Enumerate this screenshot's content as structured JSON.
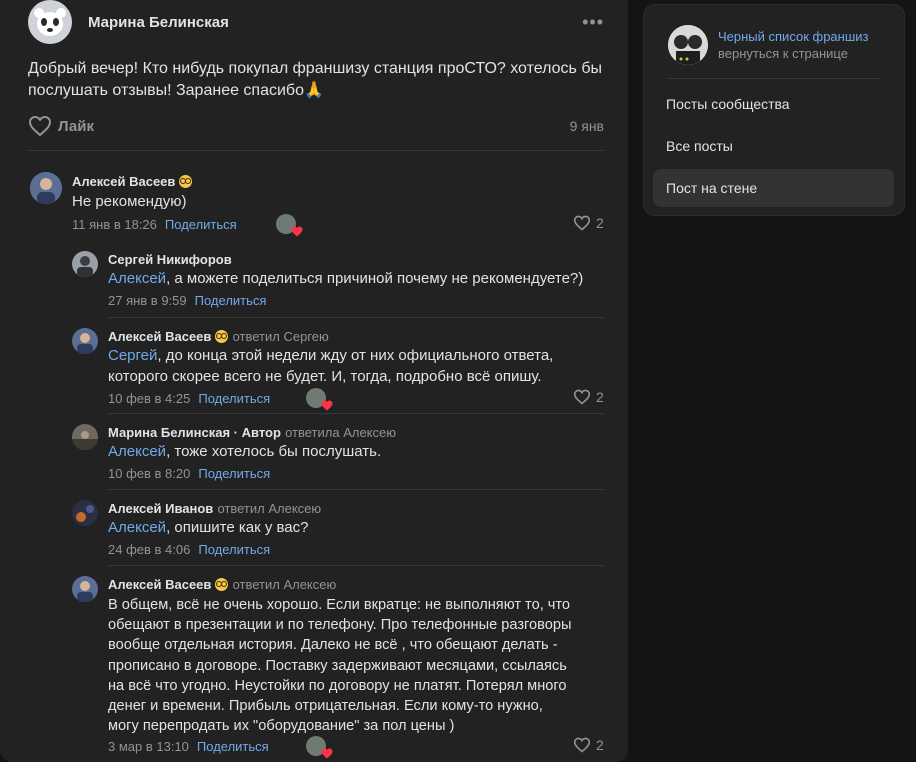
{
  "post": {
    "author": "Марина Белинская",
    "more_label": "•••",
    "text": "Добрый вечер! Кто нибудь покупал франшизу станция проСТО? хотелось бы послушать отзывы! Заранее спасибо🙏",
    "like_label": "Лайк",
    "date": "9 янв"
  },
  "comments": [
    {
      "author": "Алексей Васеев",
      "body": "Не рекомендую)",
      "date": "11 янв в 18:26",
      "share": "Поделиться",
      "likes": "2"
    },
    {
      "author": "Сергей Никифоров",
      "mention": "Алексей",
      "body": ", а можете поделиться причиной почему не рекомендуете?)",
      "date": "27 янв в 9:59",
      "share": "Поделиться"
    },
    {
      "author": "Алексей Васеев",
      "reply_to": "ответил Сергею",
      "mention": "Сергей",
      "body": ", до конца этой недели жду от них официального ответа, которого скорее всего не будет. И, тогда, подробно всё опишу.",
      "date": "10 фев в 4:25",
      "share": "Поделиться",
      "likes": "2"
    },
    {
      "author": "Марина Белинская · Автор",
      "reply_to": "ответила Алексею",
      "mention": "Алексей",
      "body": ", тоже хотелось бы послушать.",
      "date": "10 фев в 8:20",
      "share": "Поделиться"
    },
    {
      "author": "Алексей Иванов",
      "reply_to": "ответил Алексею",
      "mention": "Алексей",
      "body": ", опишите как у вас?",
      "date": "24 фев в 4:06",
      "share": "Поделиться"
    },
    {
      "author": "Алексей Васеев",
      "reply_to": "ответил Алексею",
      "body": "В общем, всё не очень хорошо. Если вкратце: не выполняют то, что обещают в презентации и по телефону. Про телефонные разговоры вообще отдельная история. Далеко не всё , что обещают делать - прописано в договоре. Поставку задерживают месяцами, ссылаясь на всё что угодно. Неустойки по договору не платят. Потерял много денег и времени. Прибыль отрицательная. Если кому-то нужно, могу перепродать их \"оборудование\" за пол цены )",
      "date": "3 мар в 13:10",
      "share": "Поделиться",
      "likes": "2"
    }
  ],
  "sidebar": {
    "group_name": "Черный список франшиз",
    "back_label": "вернуться к странице",
    "items": [
      {
        "label": "Посты сообщества"
      },
      {
        "label": "Все посты"
      },
      {
        "label": "Пост на стене"
      }
    ]
  },
  "colors": {
    "background": "#141414",
    "card": "#222222",
    "accent": "#71aaeb",
    "muted": "#909499",
    "heart": "#ff3347"
  },
  "icons": [
    "bear-avatar-icon",
    "heart-outline-icon",
    "heart-filled-icon",
    "nerd-emoji-icon",
    "more-dots-icon"
  ]
}
